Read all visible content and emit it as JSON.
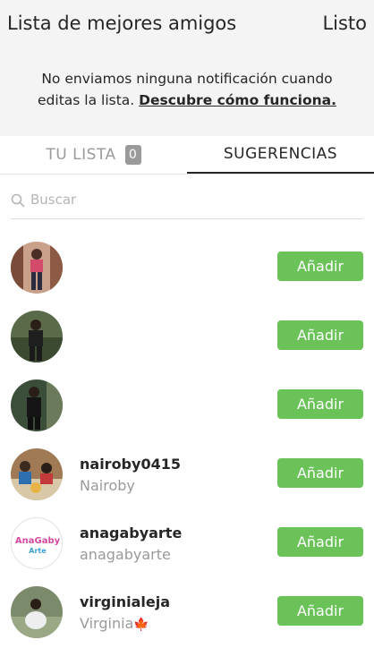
{
  "header": {
    "title": "Lista de mejores amigos",
    "done_label": "Listo"
  },
  "notice": {
    "line1": "No enviamos ninguna notificación cuando",
    "line2_prefix": "editas la lista. ",
    "link": "Descubre cómo funciona."
  },
  "tabs": {
    "your_list": "TU LISTA",
    "your_list_count": "0",
    "suggestions": "SUGERENCIAS"
  },
  "search": {
    "placeholder": "Buscar"
  },
  "add_label": "Añadir",
  "users": [
    {
      "username": "",
      "name": ""
    },
    {
      "username": "",
      "name": ""
    },
    {
      "username": "",
      "name": ""
    },
    {
      "username": "nairoby0415",
      "name": "Nairoby"
    },
    {
      "username": "anagabyarte",
      "name": "anagabyarte"
    },
    {
      "username": "virginialeja",
      "name": "Virginia"
    }
  ],
  "colors": {
    "accent_green": "#6ac259",
    "background_top": "#f4f4f4"
  },
  "icons": {
    "search": "search-icon",
    "leaf_emoji": "maple-leaf-icon"
  }
}
